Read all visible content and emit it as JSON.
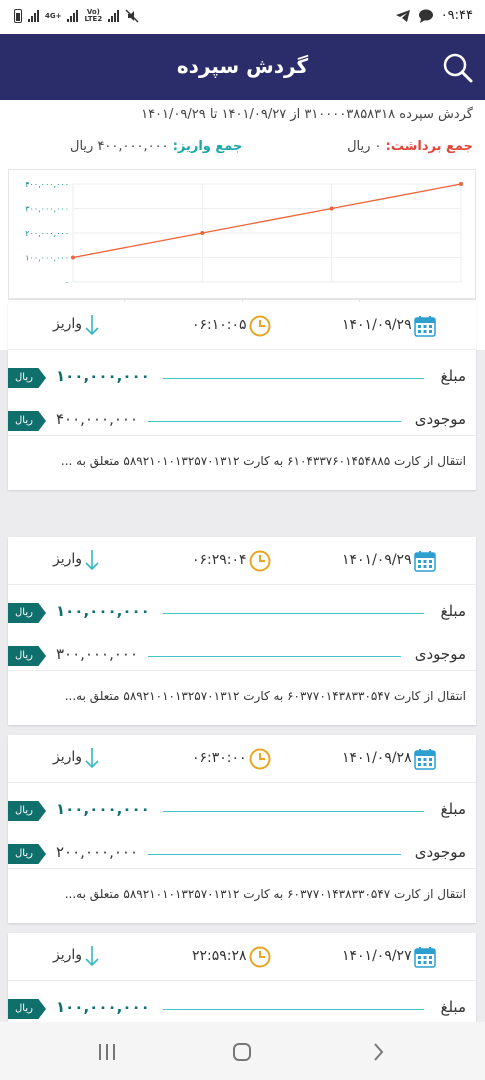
{
  "status_bar": {
    "time": "۰۹:۴۴",
    "network_1": "4G+",
    "network_2a": "Vo)",
    "network_2b": "LTE2"
  },
  "header": {
    "title": "گردش سپرده",
    "search_icon": "search-icon"
  },
  "summary": {
    "line1": "گردش سپرده ۳۱۰۰۰۰۳۸۵۸۳۱۸ از ۱۴۰۱/۰۹/۲۷ تا ۱۴۰۱/۰۹/۲۹",
    "withdraw_label": "جمع برداشت:",
    "withdraw_value": "۰ ریال",
    "deposit_label": "جمع واریز:",
    "deposit_value": "۴۰۰,۰۰۰,۰۰۰ ریال"
  },
  "chart_data": {
    "type": "line",
    "y_ticks": [
      "۴۰۰,۰۰۰,۰۰۰",
      "۳۰۰,۰۰۰,۰۰۰",
      "۲۰۰,۰۰۰,۰۰۰",
      "۱۰۰,۰۰۰,۰۰۰",
      "۰"
    ],
    "ylim": [
      0,
      400000000
    ],
    "grid": true,
    "series": [
      {
        "color": "#f0623a",
        "values": [
          100000000,
          200000000,
          300000000,
          400000000
        ]
      }
    ]
  },
  "toolbar": {
    "items": [
      {
        "icon": "bar-chart-icon",
        "color": "#b5448a"
      },
      {
        "icon": "line-chart-icon",
        "color": "#3b6ed6"
      },
      {
        "icon": "excel-icon",
        "color": "#2e8b57"
      },
      {
        "icon": "pdf-icon",
        "color": "#e05a5a"
      }
    ]
  },
  "labels": {
    "amount": "مبلغ",
    "balance": "موجودی",
    "rial": "ریال"
  },
  "transactions": [
    {
      "date": "۱۴۰۱/۰۹/۲۹",
      "time": "۰۶:۱۰:۰۵",
      "type": "واریز",
      "amount": "۱۰۰,۰۰۰,۰۰۰",
      "balance": "۴۰۰,۰۰۰,۰۰۰",
      "description": "انتقال از کارت ۶۱۰۴۳۳۷۶۰۱۴۵۴۸۸۵ به کارت ۵۸۹۲۱۰۱۰۱۳۲۵۷۰۱۳۱۲ متعلق به ..."
    },
    {
      "date": "۱۴۰۱/۰۹/۲۹",
      "time": "۰۶:۲۹:۰۴",
      "type": "واریز",
      "amount": "۱۰۰,۰۰۰,۰۰۰",
      "balance": "۳۰۰,۰۰۰,۰۰۰",
      "description": "انتقال از کارت ۶۰۳۷۷۰۱۴۳۸۳۳۰۵۴۷ به کارت ۵۸۹۲۱۰۱۰۱۳۲۵۷۰۱۳۱۲ متعلق به..."
    },
    {
      "date": "۱۴۰۱/۰۹/۲۸",
      "time": "۰۶:۳۰:۰۰",
      "type": "واریز",
      "amount": "۱۰۰,۰۰۰,۰۰۰",
      "balance": "۲۰۰,۰۰۰,۰۰۰",
      "description": "انتقال از کارت ۶۰۳۷۷۰۱۴۳۸۳۳۰۵۴۷ به کارت ۵۸۹۲۱۰۱۰۱۳۲۵۷۰۱۳۱۲ متعلق به..."
    },
    {
      "date": "۱۴۰۱/۰۹/۲۷",
      "time": "۲۲:۵۹:۲۸",
      "type": "واریز",
      "amount": "۱۰۰,۰۰۰,۰۰۰",
      "balance": "",
      "description": ""
    }
  ],
  "nav": {
    "recents": "recents-icon",
    "home": "home-icon",
    "back": "back-icon"
  }
}
